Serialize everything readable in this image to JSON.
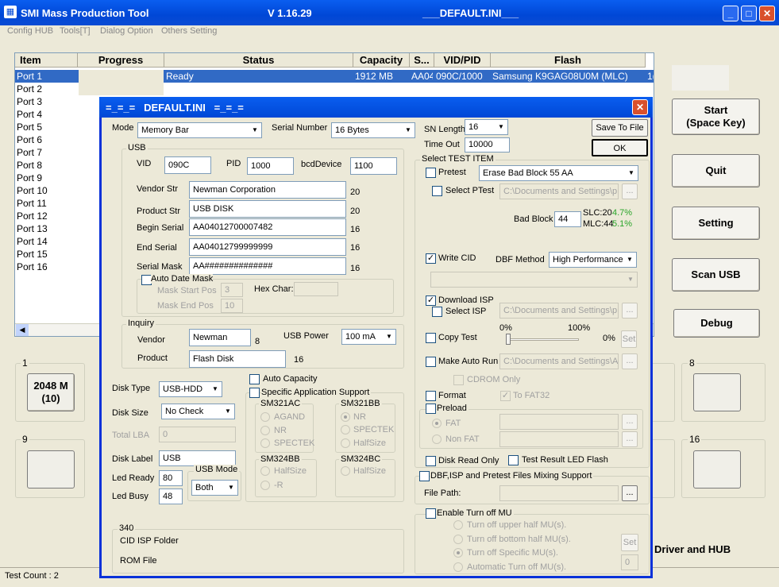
{
  "app": {
    "title": "SMI Mass Production Tool",
    "version": "V 1.16.29",
    "ini": "___DEFAULT.INI___",
    "min": "_",
    "max": "□",
    "close": "✕"
  },
  "menu": [
    "Config HUB",
    "Tools[T]",
    "Dialog Option",
    "Others Setting"
  ],
  "grid": {
    "columns": [
      "Item",
      "Progress",
      "Status",
      "Capacity",
      "S...",
      "VID/PID",
      "Flash"
    ],
    "ports": [
      "Port 1",
      "Port 2",
      "Port 3",
      "Port 4",
      "Port 5",
      "Port 6",
      "Port 7",
      "Port 8",
      "Port 9",
      "Port 10",
      "Port 11",
      "Port 12",
      "Port 13",
      "Port 14",
      "Port 15",
      "Port 16"
    ],
    "row1": {
      "status": "Ready",
      "capacity": "1912 MB",
      "s": "AA04",
      "vidpid": "090C/1000",
      "flash": "Samsung K9GAG08U0M (MLC)",
      "extra": "1("
    }
  },
  "buttons": {
    "start": "Start\n(Space Key)",
    "quit": "Quit",
    "setting": "Setting",
    "scan": "Scan USB",
    "debug": "Debug"
  },
  "slots": {
    "g1": "1",
    "g1cap": "2048 M\n(10)",
    "g9": "9",
    "g8": "8",
    "g16": "16"
  },
  "driver_hub": "Driver and HUB",
  "status": "Test Count : 2",
  "dlg": {
    "title": "=_=_=   DEFAULT.INI   =_=_=",
    "mode_label": "Mode",
    "mode": "Memory Bar",
    "sn_label": "Serial Number",
    "sn": "16 Bytes",
    "snlen_label": "SN Length",
    "snlen": "16",
    "timeout_label": "Time Out",
    "timeout": "10000",
    "save": "Save To File",
    "ok": "OK",
    "usb": "USB",
    "vid_l": "VID",
    "vid": "090C",
    "pid_l": "PID",
    "pid": "1000",
    "bcd_l": "bcdDevice",
    "bcd": "1100",
    "vendor_l": "Vendor Str",
    "vendor": "Newman Corporation",
    "vendor_n": "20",
    "product_l": "Product Str",
    "product": "USB DISK",
    "product_n": "20",
    "bserial_l": "Begin Serial",
    "bserial": "AA04012700007482",
    "bserial_n": "16",
    "eserial_l": "End Serial",
    "eserial": "AA04012799999999",
    "eserial_n": "16",
    "smask_l": "Serial Mask",
    "smask": "AA##############",
    "smask_n": "16",
    "autodate": "Auto Date Mask",
    "mstart": "Mask Start Pos",
    "mstart_v": "3",
    "mend": "Mask End Pos",
    "mend_v": "10",
    "hex": "Hex Char:",
    "inquiry": "Inquiry",
    "ivendor_l": "Vendor",
    "ivendor": "Newman",
    "ivendor_n": "8",
    "usbpower_l": "USB Power",
    "usbpower": "100 mA",
    "iproduct_l": "Product",
    "iproduct": "Flash Disk",
    "iproduct_n": "16",
    "disktype_l": "Disk Type",
    "disktype": "USB-HDD",
    "disksize_l": "Disk Size",
    "disksize": "No Check",
    "lba_l": "Total LBA",
    "lba": "0",
    "disklabel_l": "Disk Label",
    "disklabel": "USB",
    "ledready_l": "Led Ready",
    "ledready": "80",
    "ledbusy_l": "Led Busy",
    "ledbusy": "48",
    "usbmode_l": "USB Mode",
    "usbmode": "Both",
    "autocap": "Auto Capacity",
    "specapp": "Specific Application Support",
    "sm321ac": "SM321AC",
    "agand": "AGAND",
    "nr": "NR",
    "spectek": "SPECTEK",
    "sm321bb": "SM321BB",
    "nr2": "NR",
    "spectek2": "SPECTEK",
    "halfsize": "HalfSize",
    "sm324bb": "SM324BB",
    "halfsize2": "HalfSize",
    "r": "-R",
    "sm324bc": "SM324BC",
    "halfsize3": "HalfSize",
    "f340": "340",
    "cid_isp": "CID ISP Folder",
    "rom": "ROM File",
    "test_item": "Select TEST ITEM",
    "pretest": "Pretest",
    "pretest_v": "Erase Bad Block 55 AA",
    "selptest": "Select PTest",
    "path": "C:\\Documents and Settings\\p",
    "path2": "C:\\Documents and Settings\\p",
    "path3": "C:\\Documents and Settings\\A",
    "badblock_l": "Bad Block",
    "badblock": "44",
    "slc": "SLC:20",
    "slc_p": "4.7%",
    "mlc": "MLC:44",
    "mlc_p": "5.1%",
    "writecid": "Write CID",
    "dbf_l": "DBF Method",
    "dbf": "High Performance",
    "dlisp": "Download ISP",
    "selisp": "Select ISP",
    "copytest": "Copy Test",
    "p0": "0%",
    "p100": "100%",
    "pcur": "0%",
    "set": "Set",
    "autorun": "Make Auto Run",
    "cdrom": "CDROM Only",
    "format": "Format",
    "tofat": "To FAT32",
    "preload": "Preload",
    "fat": "FAT",
    "nonfat": "Non FAT",
    "readonly": "Disk Read Only",
    "ledflash": "Test Result LED Flash",
    "mixing": "DBF,ISP and Pretest Files Mixing Support",
    "filepath": "File Path:",
    "turnoff": "Enable Turn off MU",
    "mu1": "Turn off upper half MU(s).",
    "mu2": "Turn off bottom half MU(s).",
    "mu3": "Turn off Specific MU(s).",
    "mu4": "Automatic Turn off MU(s).",
    "set2": "Set",
    "mu_n": "0",
    "dots": "..."
  }
}
